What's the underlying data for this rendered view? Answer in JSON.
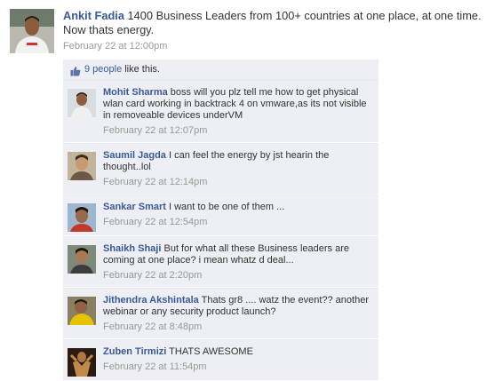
{
  "post": {
    "author": "Ankit Fadia",
    "message": "1400 Business Leaders from 100+ countries at one place, at one time. Now thats energy.",
    "timestamp": "February 22 at 12:00pm"
  },
  "likes": {
    "count_text": "9 people",
    "suffix": "like this."
  },
  "comments": [
    {
      "author": "Mohit Sharma",
      "text": "boss will you plz tell me how to get physical wlan card working in backtrack 4 on vmware,as its not visible in removeable devices underVM",
      "timestamp": "February 22 at 12:07pm"
    },
    {
      "author": "Saumil Jagda",
      "text": "I can feel the energy by jst hearin the thought..lol",
      "timestamp": "February 22 at 12:14pm"
    },
    {
      "author": "Sankar Smart",
      "text": "I want to be one of them ...",
      "timestamp": "February 22 at 12:54pm"
    },
    {
      "author": "Shaikh Shaji",
      "text": "But for what all these Business leaders are coming at one place? i mean whatz d deal...",
      "timestamp": "February 22 at 2:20pm"
    },
    {
      "author": "Jithendra Akshintala",
      "text": "Thats gr8 .... watz the event?? another webinar or any security product launch?",
      "timestamp": "February 22 at 8:48pm"
    },
    {
      "author": "Zuben Tirmizi",
      "text": "THATS AWESOME",
      "timestamp": "February 22 at 11:54pm"
    }
  ],
  "colors": {
    "link": "#3b5998",
    "text": "#333333",
    "timestamp": "#999999",
    "feedback_bg": "#edeff4"
  }
}
